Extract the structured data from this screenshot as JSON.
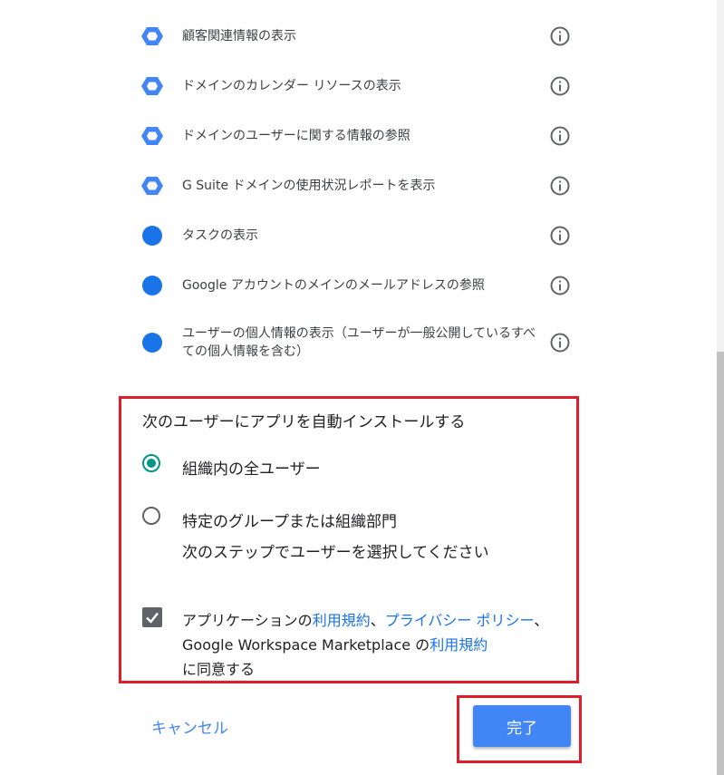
{
  "permissions": [
    {
      "label": "顧客関連情報の表示",
      "icon": "hexagon-icon"
    },
    {
      "label": "ドメインのカレンダー リソースの表示",
      "icon": "hexagon-icon"
    },
    {
      "label": "ドメインのユーザーに関する情報の参照",
      "icon": "hexagon-icon"
    },
    {
      "label": "G Suite ドメインの使用状況レポートを表示",
      "icon": "hexagon-icon"
    },
    {
      "label": "タスクの表示",
      "icon": "circle-icon"
    },
    {
      "label": "Google アカウントのメインのメールアドレスの参照",
      "icon": "circle-icon"
    },
    {
      "label": "ユーザーの個人情報の表示（ユーザーが一般公開しているすべての個人情報を含む）",
      "icon": "circle-icon"
    }
  ],
  "install": {
    "title": "次のユーザーにアプリを自動インストールする",
    "option_all": "組織内の全ユーザー",
    "option_group": "特定のグループまたは組織部門",
    "option_group_sub": "次のステップでユーザーを選択してください"
  },
  "consent": {
    "prefix": "アプリケーションの",
    "terms": "利用規約",
    "sep1": "、",
    "privacy": "プライバシー ポリシー",
    "sep2": "、Google Workspace Marketplace の",
    "marketplace_terms": "利用規約",
    "suffix": "に同意する"
  },
  "buttons": {
    "cancel": "キャンセル",
    "done": "完了"
  },
  "colors": {
    "accent": "#4285f4",
    "link": "#1a73e8",
    "radio": "#009688",
    "highlight": "#e01e2b"
  }
}
